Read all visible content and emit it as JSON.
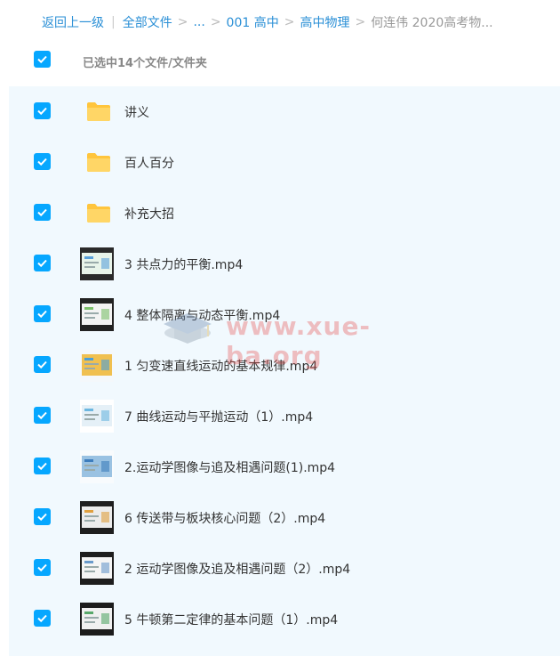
{
  "breadcrumb": {
    "back": "返回上一级",
    "all_files": "全部文件",
    "ellipsis": "...",
    "level1": "001 高中",
    "level2": "高中物理",
    "current": "何连伟 2020高考物..."
  },
  "header": {
    "selected_text": "已选中14个文件/文件夹"
  },
  "colors": {
    "accent": "#06a7ff",
    "link": "#2a8fd6",
    "folder": "#ffc53d",
    "list_bg": "#f1f9fe"
  },
  "watermark": {
    "text": "www.xue-ba.org"
  },
  "items": [
    {
      "type": "folder",
      "icon": "folder-icon",
      "name": "讲义"
    },
    {
      "type": "folder",
      "icon": "folder-icon",
      "name": "百人百分"
    },
    {
      "type": "folder",
      "icon": "folder-icon",
      "name": "补充大招"
    },
    {
      "type": "video",
      "icon": "video-thumbnail",
      "name": "3 共点力的平衡.mp4"
    },
    {
      "type": "video",
      "icon": "video-thumbnail",
      "name": "4 整体隔离与动态平衡.mp4"
    },
    {
      "type": "video",
      "icon": "video-thumbnail",
      "name": "1 匀变速直线运动的基本规律.mp4"
    },
    {
      "type": "video",
      "icon": "video-thumbnail",
      "name": "7 曲线运动与平抛运动（1）.mp4"
    },
    {
      "type": "video",
      "icon": "video-thumbnail",
      "name": "2.运动学图像与追及相遇问题(1).mp4"
    },
    {
      "type": "video",
      "icon": "video-thumbnail",
      "name": "6 传送带与板块核心问题（2）.mp4"
    },
    {
      "type": "video",
      "icon": "video-thumbnail",
      "name": "2 运动学图像及追及相遇问题（2）.mp4"
    },
    {
      "type": "video",
      "icon": "video-thumbnail",
      "name": "5 牛顿第二定律的基本问题（1）.mp4"
    }
  ]
}
